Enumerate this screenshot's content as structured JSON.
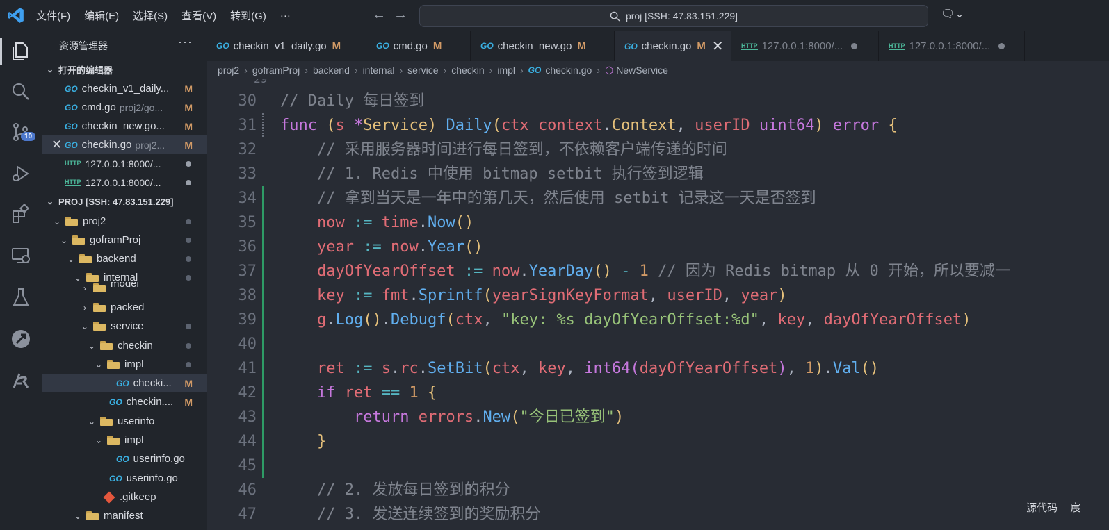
{
  "menu": [
    "文件(F)",
    "编辑(E)",
    "选择(S)",
    "查看(V)",
    "转到(G)",
    "···"
  ],
  "search": {
    "text": "proj [SSH: 47.83.151.229]"
  },
  "activity": {
    "scm_badge": "10"
  },
  "sidebar": {
    "title": "资源管理器",
    "more": "···",
    "open_editors": {
      "header": "打开的编辑器",
      "items": [
        {
          "name": "checkin_v1_daily...",
          "dim": "",
          "status": "M"
        },
        {
          "name": "cmd.go",
          "dim": "proj2/go...",
          "status": "M"
        },
        {
          "name": "checkin_new.go...",
          "dim": "",
          "status": "M"
        },
        {
          "name": "checkin.go",
          "dim": "proj2...",
          "status": "M"
        },
        {
          "name": "127.0.0.1:8000/...",
          "dim": "",
          "status": ""
        },
        {
          "name": "127.0.0.1:8000/...",
          "dim": "",
          "status": ""
        }
      ]
    },
    "project": {
      "header": "PROJ [SSH: 47.83.151.229]",
      "items": [
        {
          "name": "proj2"
        },
        {
          "name": "goframProj"
        },
        {
          "name": "backend"
        },
        {
          "name": "internal"
        },
        {
          "name": "model"
        },
        {
          "name": "packed"
        },
        {
          "name": "service"
        },
        {
          "name": "checkin"
        },
        {
          "name": "impl"
        },
        {
          "name": "checki...",
          "status": "M"
        },
        {
          "name": "checkin....",
          "status": "M"
        },
        {
          "name": "userinfo"
        },
        {
          "name": "impl"
        },
        {
          "name": "userinfo.go"
        },
        {
          "name": "userinfo.go"
        },
        {
          "name": ".gitkeep"
        },
        {
          "name": "manifest"
        }
      ]
    }
  },
  "tabs": [
    {
      "label": "checkin_v1_daily.go",
      "status": "M"
    },
    {
      "label": "cmd.go",
      "status": "M"
    },
    {
      "label": "checkin_new.go",
      "status": "M"
    },
    {
      "label": "checkin.go",
      "status": "M"
    },
    {
      "label": "127.0.0.1:8000/..."
    },
    {
      "label": "127.0.0.1:8000/..."
    }
  ],
  "breadcrumb": [
    "proj2",
    "goframProj",
    "backend",
    "internal",
    "service",
    "checkin",
    "impl",
    "checkin.go",
    "NewService"
  ],
  "code": {
    "line_numbers": [
      "30",
      "31",
      "32",
      "33",
      "34",
      "35",
      "36",
      "37",
      "38",
      "39",
      "40",
      "41",
      "42",
      "43",
      "44",
      "45",
      "46",
      "47"
    ],
    "lines": [
      "// Daily 每日签到",
      "func (s *Service) Daily(ctx context.Context, userID uint64) error {",
      "    // 采用服务器时间进行每日签到，不依赖客户端传递的时间",
      "    // 1. Redis 中使用 bitmap setbit 执行签到逻辑",
      "    // 拿到当天是一年中的第几天，然后使用 setbit 记录这一天是否签到",
      "    now := time.Now()",
      "    year := now.Year()",
      "    dayOfYearOffset := now.YearDay() - 1 // 因为 Redis bitmap 从 0 开始，所以要减一",
      "    key := fmt.Sprintf(yearSignKeyFormat, userID, year)",
      "    g.Log().Debugf(ctx, \"key: %s dayOfYearOffset:%d\", key, dayOfYearOffset)",
      "",
      "    ret := s.rc.SetBit(ctx, key, int64(dayOfYearOffset), 1).Val()",
      "    if ret == 1 {",
      "        return errors.New(\"今日已签到\")",
      "    }",
      "",
      "    // 2. 发放每日签到的积分",
      "    // 3. 发送连续签到的奖励积分"
    ]
  },
  "status_floating": [
    "源代码",
    "宸"
  ]
}
